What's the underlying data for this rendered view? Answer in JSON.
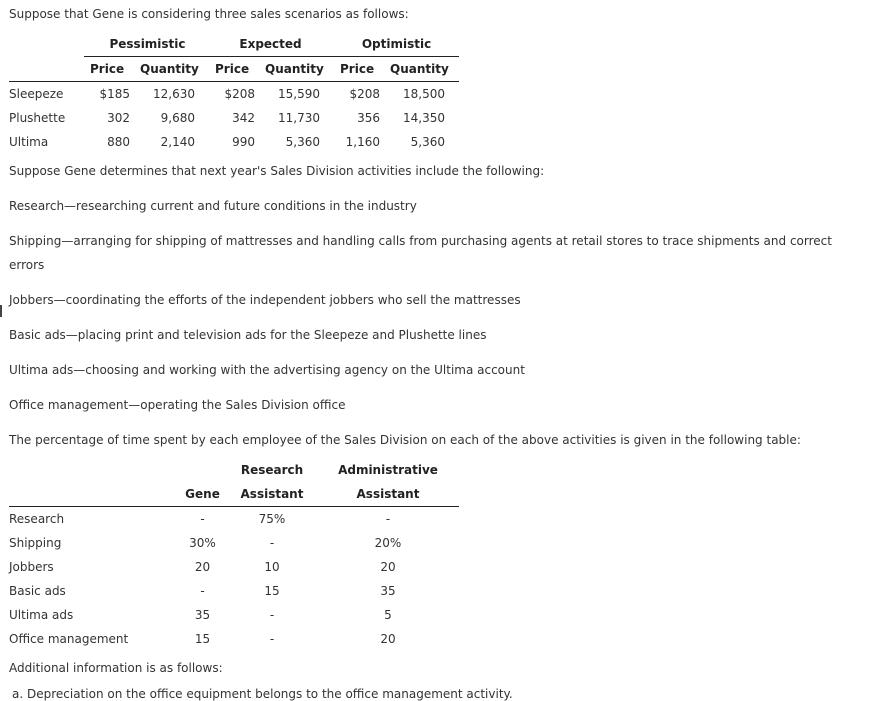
{
  "intro": "Suppose that Gene is considering three sales scenarios as follows:",
  "scenarios_table": {
    "groups": [
      "Pessimistic",
      "Expected",
      "Optimistic"
    ],
    "subheaders": [
      "Price",
      "Quantity",
      "Price",
      "Quantity",
      "Price",
      "Quantity"
    ],
    "rows": [
      {
        "label": "Sleepeze",
        "values": [
          "$185",
          "12,630",
          "$208",
          "15,590",
          "$208",
          "18,500"
        ]
      },
      {
        "label": "Plushette",
        "values": [
          "302",
          "9,680",
          "342",
          "11,730",
          "356",
          "14,350"
        ]
      },
      {
        "label": "Ultima",
        "values": [
          "880",
          "2,140",
          "990",
          "5,360",
          "1,160",
          "5,360"
        ]
      }
    ]
  },
  "activities_intro": "Suppose Gene determines that next year's Sales Division activities include the following:",
  "activities": [
    "Research—researching current and future conditions in the industry",
    "Shipping—arranging for shipping of mattresses and handling calls from purchasing agents at retail stores to trace shipments and correct",
    "errors",
    "Jobbers—coordinating the efforts of the independent jobbers who sell the mattresses",
    "Basic ads—placing print and television ads for the Sleepeze and Plushette lines",
    "Ultima ads—choosing and working with the advertising agency on the Ultima account",
    "Office management—operating the Sales Division office"
  ],
  "time_intro": "The percentage of time spent by each employee of the Sales Division on each of the above activities is given in the following table:",
  "time_table": {
    "headers": {
      "gene": "Gene",
      "research_top": "Research",
      "research_bottom": "Assistant",
      "admin_top": "Administrative",
      "admin_bottom": "Assistant"
    },
    "rows": [
      {
        "label": "Research",
        "values": [
          "-",
          "75%",
          "-"
        ]
      },
      {
        "label": "Shipping",
        "values": [
          "30%",
          "-",
          "20%"
        ]
      },
      {
        "label": "Jobbers",
        "values": [
          "20",
          "10",
          "20"
        ]
      },
      {
        "label": "Basic ads",
        "values": [
          "-",
          "15",
          "35"
        ]
      },
      {
        "label": "Ultima ads",
        "values": [
          "35",
          "-",
          "5"
        ]
      },
      {
        "label": "Office management",
        "values": [
          "15",
          "-",
          "20"
        ]
      }
    ]
  },
  "additional_intro": "Additional information is as follows:",
  "additional_items": [
    "a. Depreciation on the office equipment belongs to the office management activity."
  ]
}
